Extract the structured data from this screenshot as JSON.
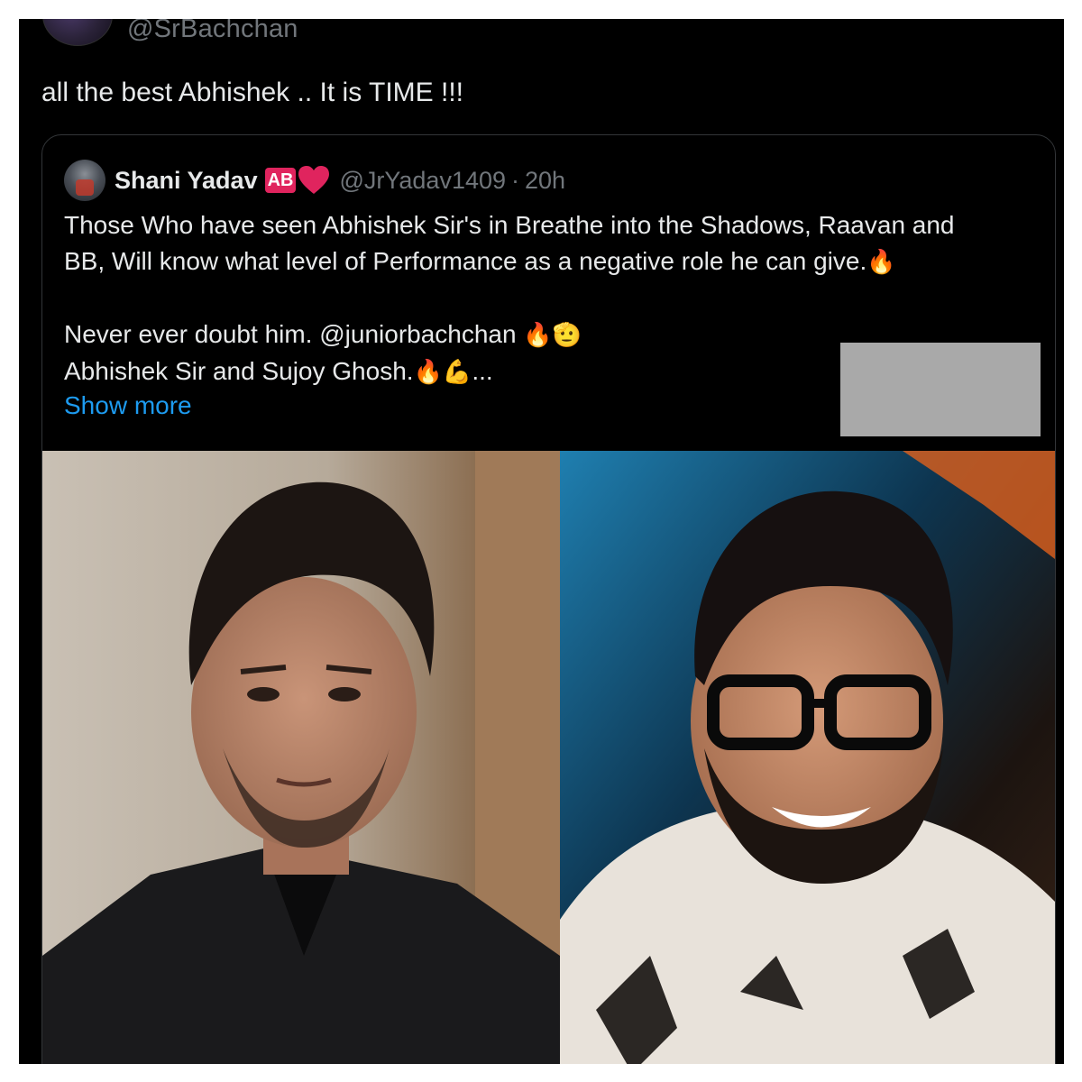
{
  "author": {
    "handle": "@SrBachchan",
    "avatar_icon": "user-avatar"
  },
  "tweet": {
    "text": "all the best Abhishek .. It is TIME !!!"
  },
  "quoted_tweet": {
    "name": "Shani Yadav",
    "badge": "AB",
    "badge_color": "#e0245e",
    "heart_icon": "heart-icon",
    "heart_color": "#f91880",
    "handle": "@JrYadav1409",
    "separator": "·",
    "time": "20h",
    "lines": [
      "Those Who have seen Abhishek Sir's in Breathe into the Shadows, Raavan and",
      "BB, Will know what level of Performance as a negative role he can give.",
      "Never ever doubt him. @juniorbachchan",
      "Abhishek Sir and Sujoy Ghosh."
    ],
    "emojis": {
      "line2_end": "🔥",
      "line3_end": "🔥🫡",
      "line4_end": "🔥💪",
      "ellipsis": "..."
    },
    "show_more": "Show more",
    "link_color": "#1d9bf0"
  },
  "media": {
    "left_photo": "man-in-black-suit-photo",
    "right_photo": "smiling-man-with-glasses-photo"
  },
  "colors": {
    "background": "#000000",
    "text": "#e7e9ea",
    "muted": "#71767b",
    "border": "#333639",
    "redaction": "#a9a9a9"
  }
}
